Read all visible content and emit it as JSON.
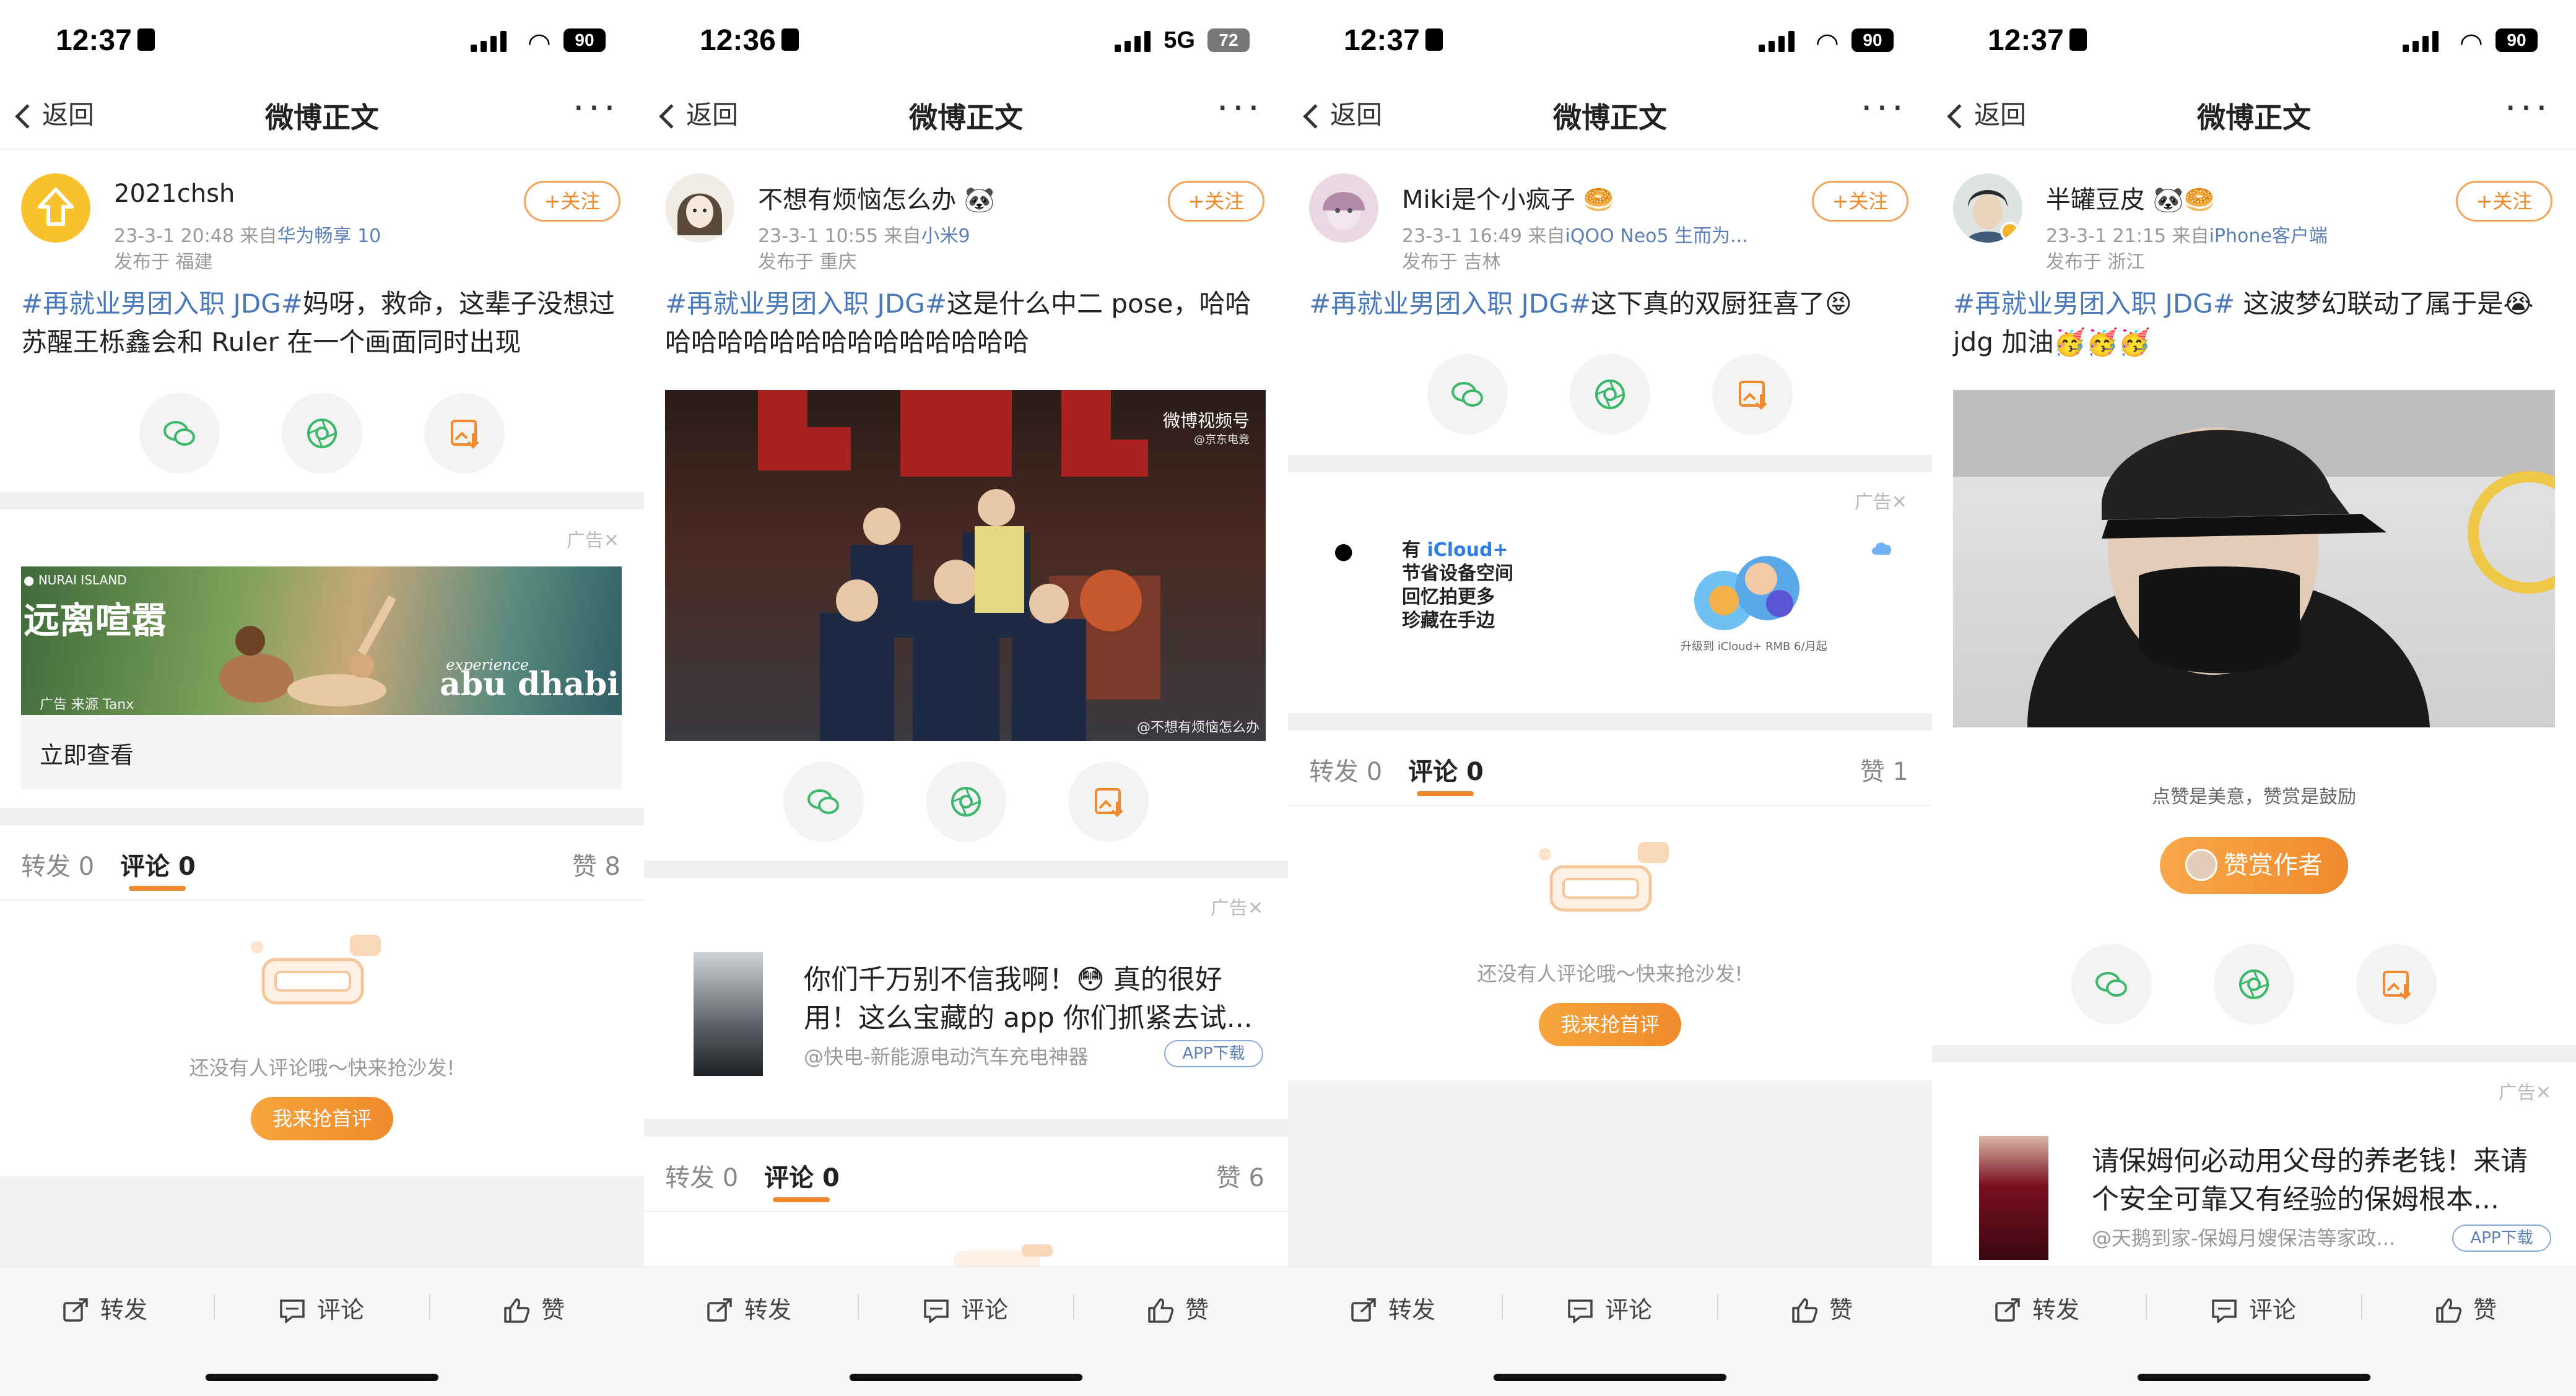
{
  "common": {
    "nav_back": "返回",
    "nav_title": "微博正文",
    "nav_more": "···",
    "follow": "+关注",
    "ad_tag": "广告✕",
    "tab_repost": "转发",
    "tab_comment": "评论",
    "tab_like": "赞",
    "empty_text": "还没有人评论哦～快来抢沙发!",
    "first_comment_btn": "我来抢首评",
    "bottom_repost": "转发",
    "bottom_comment": "评论",
    "bottom_like": "赞",
    "download_btn": "APP下载",
    "accent_color": "#f08a2c",
    "link_color": "#4a78b8"
  },
  "screens": [
    {
      "status": {
        "time": "12:37",
        "battery": "90",
        "network": "wifi"
      },
      "author": {
        "name": "2021chsh",
        "time": "23-3-1 20:48",
        "from_prefix": "来自",
        "source": "华为畅享 10",
        "location": "发布于 福建"
      },
      "post": {
        "tag": "#再就业男团入职 JDG#",
        "text": "妈呀，救命，这辈子没想过苏醒王栎鑫会和 Ruler 在一个画面同时出现"
      },
      "ad": {
        "location_label": "NURAI ISLAND",
        "headline": "远离喧嚣",
        "brand_line1": "experience",
        "brand_line2": "abu dhabi",
        "source_line": "广告 来源 Tanx",
        "cta": "立即查看"
      },
      "counts": {
        "repost": "0",
        "comment": "0",
        "like": "8"
      }
    },
    {
      "status": {
        "time": "12:36",
        "battery": "72",
        "network": "5G"
      },
      "author": {
        "name": "不想有烦恼怎么办",
        "time": "23-3-1 10:55",
        "from_prefix": "来自",
        "source": "小米9",
        "location": "发布于 重庆"
      },
      "post": {
        "tag": "#再就业男团入职 JDG#",
        "text": "这是什么中二 pose，哈哈哈哈哈哈哈哈哈哈哈哈哈哈哈哈"
      },
      "video": {
        "watermark_top": "微博视频号",
        "watermark_sub": "@京东电竞",
        "watermark_bottom": "@不想有烦恼怎么办"
      },
      "ad": {
        "title": "你们千万别不信我啊！😳 真的很好用！这么宝藏的 app 你们抓紧去试...",
        "source": "@快电-新能源电动汽车充电神器"
      },
      "counts": {
        "repost": "0",
        "comment": "0",
        "like": "6"
      }
    },
    {
      "status": {
        "time": "12:37",
        "battery": "90",
        "network": "wifi"
      },
      "author": {
        "name": "Miki是个小疯子",
        "time": "23-3-1 16:49",
        "from_prefix": "来自",
        "source": "iQOO Neo5 生而为...",
        "location": "发布于 吉林"
      },
      "post": {
        "tag": "#再就业男团入职 JDG#",
        "text": "这下真的双厨狂喜了😝"
      },
      "ad": {
        "line1_prefix": "有",
        "line1_brand": "iCloud+",
        "line2": "节省设备空间",
        "line3": "回忆拍更多",
        "line4": "珍藏在手边",
        "fine_print": "升级到 iCloud+ RMB 6/月起"
      },
      "counts": {
        "repost": "0",
        "comment": "0",
        "like": "1"
      }
    },
    {
      "status": {
        "time": "12:37",
        "battery": "90",
        "network": "wifi"
      },
      "author": {
        "name": "半罐豆皮",
        "time": "23-3-1 21:15",
        "from_prefix": "来自",
        "source": "iPhone客户端",
        "location": "发布于 浙江"
      },
      "post": {
        "tag": "#再就业男团入职 JDG#",
        "text": " 这波梦幻联动了属于是😭 jdg 加油🥳🥳🥳"
      },
      "reward": {
        "caption": "点赞是美意，赞赏是鼓励",
        "button": "赞赏作者"
      },
      "ad": {
        "title": "请保姆何必动用父母的养老钱！来请个安全可靠又有经验的保姆根本...",
        "source": "@天鹅到家-保姆月嫂保洁等家政..."
      }
    }
  ]
}
